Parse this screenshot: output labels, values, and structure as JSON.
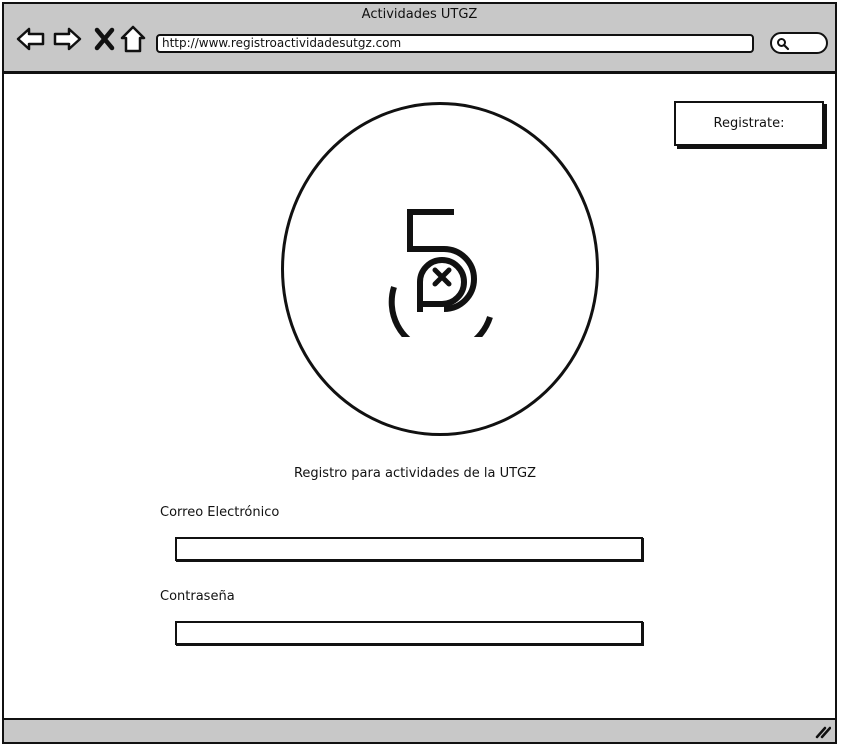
{
  "window": {
    "title": "Actividades UTGZ"
  },
  "browser": {
    "url": "http://www.registroactividadesutgz.com",
    "icons": [
      "back-arrow-icon",
      "forward-arrow-icon",
      "close-x-icon",
      "home-icon",
      "search-icon"
    ]
  },
  "header": {
    "register_label": "Registrate:"
  },
  "logo": {
    "icon": "5p-logo-icon"
  },
  "form": {
    "caption": "Registro para actividades de la UTGZ",
    "email_label": "Correo Electrónico",
    "email_value": "",
    "password_label": "Contraseña",
    "password_value": ""
  }
}
